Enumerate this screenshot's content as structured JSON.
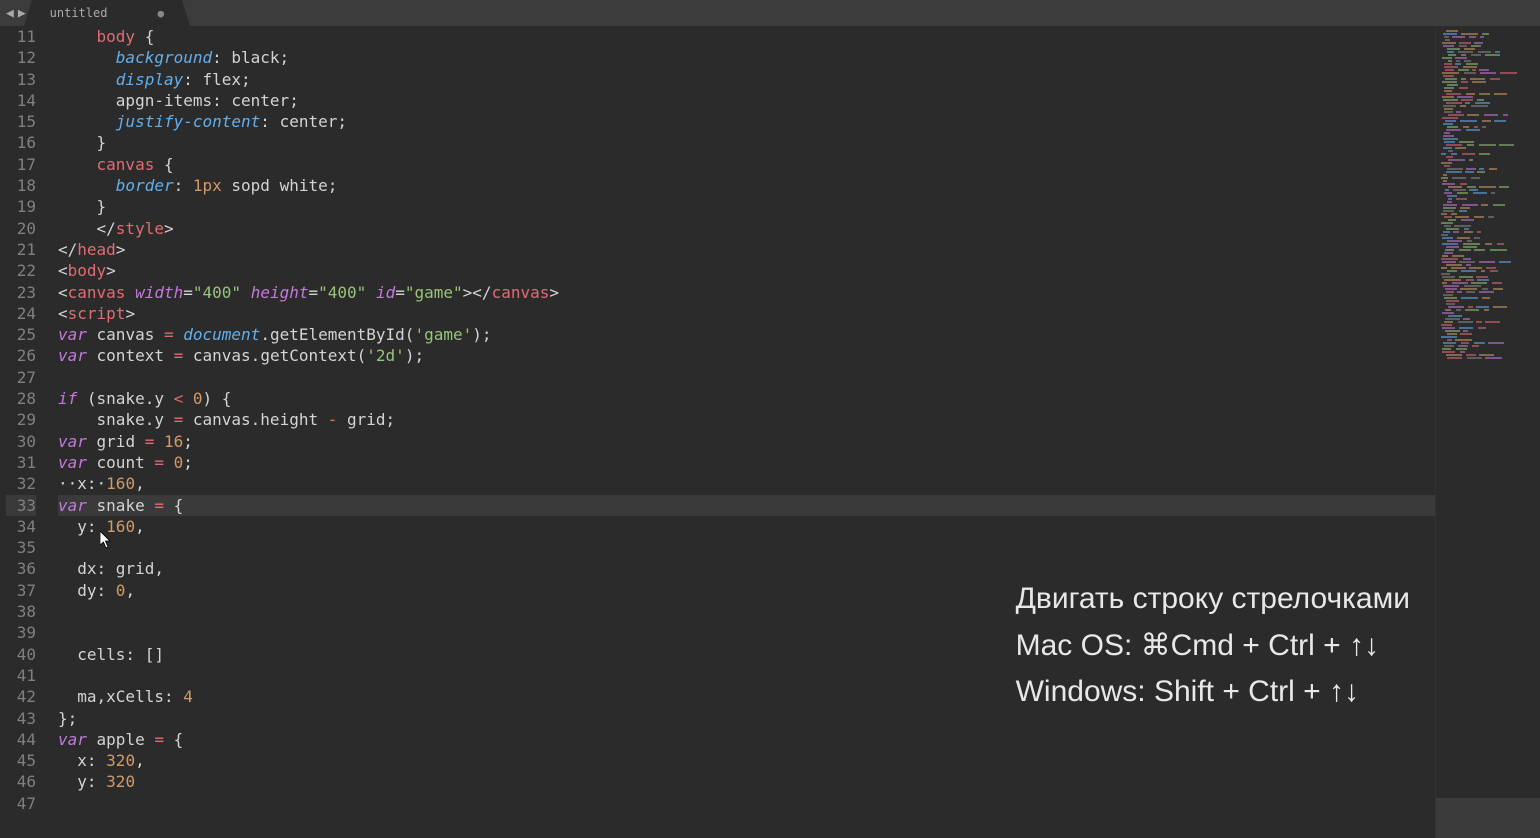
{
  "tab": {
    "label": "untitled",
    "dirty_indicator": "●"
  },
  "nav": {
    "back": "◀",
    "forward": "▶"
  },
  "gutter": {
    "start": 11,
    "end": 47,
    "highlighted": 33
  },
  "code_lines": [
    [
      {
        "cls": "c-white",
        "txt": "    "
      },
      {
        "cls": "c-tag",
        "txt": "body"
      },
      {
        "cls": "c-white",
        "txt": " {"
      }
    ],
    [
      {
        "cls": "c-white",
        "txt": "      "
      },
      {
        "cls": "c-prop",
        "txt": "background"
      },
      {
        "cls": "c-white",
        "txt": ": black;"
      }
    ],
    [
      {
        "cls": "c-white",
        "txt": "      "
      },
      {
        "cls": "c-prop",
        "txt": "display"
      },
      {
        "cls": "c-white",
        "txt": ": flex;"
      }
    ],
    [
      {
        "cls": "c-white",
        "txt": "      apgn-items: center;"
      }
    ],
    [
      {
        "cls": "c-white",
        "txt": "      "
      },
      {
        "cls": "c-prop",
        "txt": "justify-content"
      },
      {
        "cls": "c-white",
        "txt": ": center;"
      }
    ],
    [
      {
        "cls": "c-white",
        "txt": "    }"
      }
    ],
    [
      {
        "cls": "c-white",
        "txt": "    "
      },
      {
        "cls": "c-tag",
        "txt": "canvas"
      },
      {
        "cls": "c-white",
        "txt": " {"
      }
    ],
    [
      {
        "cls": "c-white",
        "txt": "      "
      },
      {
        "cls": "c-prop",
        "txt": "border"
      },
      {
        "cls": "c-white",
        "txt": ": "
      },
      {
        "cls": "c-num",
        "txt": "1px"
      },
      {
        "cls": "c-white",
        "txt": " sopd white;"
      }
    ],
    [
      {
        "cls": "c-white",
        "txt": "    }"
      }
    ],
    [
      {
        "cls": "c-white",
        "txt": "    </"
      },
      {
        "cls": "c-tag",
        "txt": "style"
      },
      {
        "cls": "c-white",
        "txt": ">"
      }
    ],
    [
      {
        "cls": "c-white",
        "txt": "</"
      },
      {
        "cls": "c-tag",
        "txt": "head"
      },
      {
        "cls": "c-white",
        "txt": ">"
      }
    ],
    [
      {
        "cls": "c-white",
        "txt": "<"
      },
      {
        "cls": "c-tag",
        "txt": "body"
      },
      {
        "cls": "c-white",
        "txt": ">"
      }
    ],
    [
      {
        "cls": "c-white",
        "txt": "<"
      },
      {
        "cls": "c-tag",
        "txt": "canvas"
      },
      {
        "cls": "c-white",
        "txt": " "
      },
      {
        "cls": "c-attr",
        "txt": "width"
      },
      {
        "cls": "c-white",
        "txt": "="
      },
      {
        "cls": "c-str",
        "txt": "\"400\""
      },
      {
        "cls": "c-white",
        "txt": " "
      },
      {
        "cls": "c-attr",
        "txt": "height"
      },
      {
        "cls": "c-white",
        "txt": "="
      },
      {
        "cls": "c-str",
        "txt": "\"400\""
      },
      {
        "cls": "c-white",
        "txt": " "
      },
      {
        "cls": "c-attr",
        "txt": "id"
      },
      {
        "cls": "c-white",
        "txt": "="
      },
      {
        "cls": "c-str",
        "txt": "\"game\""
      },
      {
        "cls": "c-white",
        "txt": "></"
      },
      {
        "cls": "c-tag",
        "txt": "canvas"
      },
      {
        "cls": "c-white",
        "txt": ">"
      }
    ],
    [
      {
        "cls": "c-white",
        "txt": "<"
      },
      {
        "cls": "c-tag",
        "txt": "script"
      },
      {
        "cls": "c-white",
        "txt": ">"
      }
    ],
    [
      {
        "cls": "c-kw",
        "txt": "var"
      },
      {
        "cls": "c-white",
        "txt": " canvas "
      },
      {
        "cls": "c-op",
        "txt": "="
      },
      {
        "cls": "c-white",
        "txt": " "
      },
      {
        "cls": "c-obj",
        "txt": "document"
      },
      {
        "cls": "c-white",
        "txt": ".getElementById("
      },
      {
        "cls": "c-str",
        "txt": "'game'"
      },
      {
        "cls": "c-white",
        "txt": ");"
      }
    ],
    [
      {
        "cls": "c-kw",
        "txt": "var"
      },
      {
        "cls": "c-white",
        "txt": " context "
      },
      {
        "cls": "c-op",
        "txt": "="
      },
      {
        "cls": "c-white",
        "txt": " canvas.getContext("
      },
      {
        "cls": "c-str",
        "txt": "'2d'"
      },
      {
        "cls": "c-white",
        "txt": ");"
      }
    ],
    [],
    [
      {
        "cls": "c-kw",
        "txt": "if"
      },
      {
        "cls": "c-white",
        "txt": " (snake.y "
      },
      {
        "cls": "c-op",
        "txt": "<"
      },
      {
        "cls": "c-white",
        "txt": " "
      },
      {
        "cls": "c-num",
        "txt": "0"
      },
      {
        "cls": "c-white",
        "txt": ") {"
      }
    ],
    [
      {
        "cls": "c-white",
        "txt": "    snake.y "
      },
      {
        "cls": "c-op",
        "txt": "="
      },
      {
        "cls": "c-white",
        "txt": " canvas.height "
      },
      {
        "cls": "c-op",
        "txt": "-"
      },
      {
        "cls": "c-white",
        "txt": " grid;"
      }
    ],
    [
      {
        "cls": "c-kw",
        "txt": "var"
      },
      {
        "cls": "c-white",
        "txt": " grid "
      },
      {
        "cls": "c-op",
        "txt": "="
      },
      {
        "cls": "c-white",
        "txt": " "
      },
      {
        "cls": "c-num",
        "txt": "16"
      },
      {
        "cls": "c-white",
        "txt": ";"
      }
    ],
    [
      {
        "cls": "c-kw",
        "txt": "var"
      },
      {
        "cls": "c-white",
        "txt": " count "
      },
      {
        "cls": "c-op",
        "txt": "="
      },
      {
        "cls": "c-white",
        "txt": " "
      },
      {
        "cls": "c-num",
        "txt": "0"
      },
      {
        "cls": "c-white",
        "txt": ";"
      }
    ],
    [
      {
        "cls": "c-white",
        "txt": "··x:·"
      },
      {
        "cls": "c-num",
        "txt": "160"
      },
      {
        "cls": "c-white",
        "txt": ","
      }
    ],
    [
      {
        "cls": "c-kw",
        "txt": "var"
      },
      {
        "cls": "c-white",
        "txt": " snake "
      },
      {
        "cls": "c-op",
        "txt": "="
      },
      {
        "cls": "c-white",
        "txt": " {"
      }
    ],
    [
      {
        "cls": "c-white",
        "txt": "  y: "
      },
      {
        "cls": "c-num",
        "txt": "160"
      },
      {
        "cls": "c-white",
        "txt": ","
      }
    ],
    [],
    [
      {
        "cls": "c-white",
        "txt": "  dx: grid,"
      }
    ],
    [
      {
        "cls": "c-white",
        "txt": "  dy: "
      },
      {
        "cls": "c-num",
        "txt": "0"
      },
      {
        "cls": "c-white",
        "txt": ","
      }
    ],
    [],
    [],
    [
      {
        "cls": "c-white",
        "txt": "  cells: []"
      }
    ],
    [],
    [
      {
        "cls": "c-white",
        "txt": "  ma,xCells: "
      },
      {
        "cls": "c-num",
        "txt": "4"
      }
    ],
    [
      {
        "cls": "c-white",
        "txt": "};"
      }
    ],
    [
      {
        "cls": "c-kw",
        "txt": "var"
      },
      {
        "cls": "c-white",
        "txt": " apple "
      },
      {
        "cls": "c-op",
        "txt": "="
      },
      {
        "cls": "c-white",
        "txt": " {"
      }
    ],
    [
      {
        "cls": "c-white",
        "txt": "  x: "
      },
      {
        "cls": "c-num",
        "txt": "320"
      },
      {
        "cls": "c-white",
        "txt": ","
      }
    ],
    [
      {
        "cls": "c-white",
        "txt": "  y: "
      },
      {
        "cls": "c-num",
        "txt": "320"
      }
    ]
  ],
  "overlay": {
    "line1": "Двигать строку стрелочками",
    "line2": "Mac OS: ⌘Cmd + Ctrl + ↑↓",
    "line3": "Windows: Shift + Ctrl + ↑↓"
  }
}
